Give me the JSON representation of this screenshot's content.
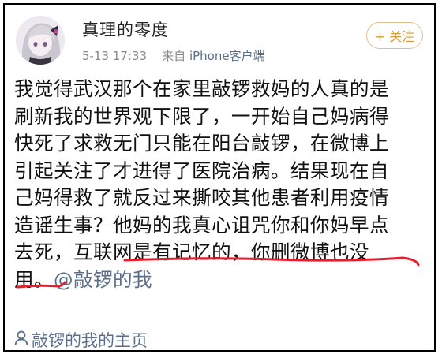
{
  "post": {
    "username": "真理的零度",
    "timestamp": "5-13 17:33",
    "source_prefix": "来自",
    "source": "iPhone客户端",
    "follow_label": "+ 关注",
    "body_lines": [
      "我觉得武汉那个在家里敲锣救妈的人真的是",
      "刷新我的世界观下限了，一开始自己妈病得",
      "快死了求救无门只能在阳台敲锣，在微博上",
      "引起关注了才进得了医院治病。结果现在自",
      "己妈得救了就反过来撕咬其他患者利用疫情",
      "造谣生事？他妈的我真心诅咒你和你妈早点",
      "去死，互联网是有记忆的，你删微博也没"
    ],
    "last_line_text": "用。",
    "mention": "@敲锣的我",
    "home_link": "敲锣的我的主页",
    "colors": {
      "link": "#5a6e8a",
      "follow_accent": "#d79b3c",
      "underline": "#e0202e"
    },
    "icons": {
      "avatar": "anime-girl-avatar",
      "home": "person-icon"
    }
  }
}
